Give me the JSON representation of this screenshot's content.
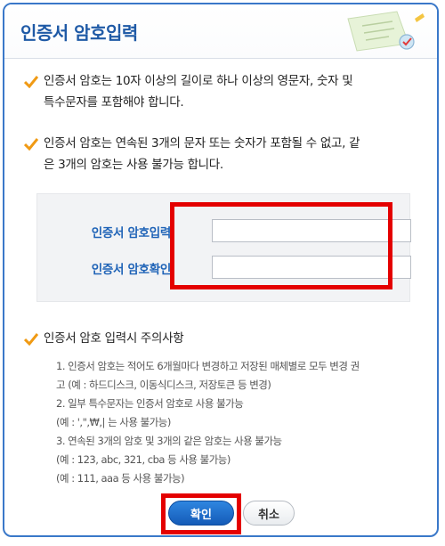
{
  "dialog": {
    "title": "인증서 암호입력"
  },
  "rules": [
    {
      "line1": "인증서 암호는 10자 이상의 길이로 하나 이상의 영문자, 숫자 및",
      "line2": "특수문자를 포함해야 합니다."
    },
    {
      "line1": "인증서 암호는 연속된 3개의 문자 또는 숫자가 포함될 수 없고, 같",
      "line2": "은 3개의 암호는 사용 불가능 합니다."
    }
  ],
  "form": {
    "password_label": "인증서 암호입력",
    "password_value": "",
    "confirm_label": "인증서 암호확인",
    "confirm_value": ""
  },
  "cautions": {
    "heading": "인증서 암호 입력시 주의사항",
    "lines": [
      "1.  인증서 암호는 적어도 6개월마다 변경하고 저장된 매체별로 모두 변경 권",
      "    고 (예 : 하드디스크, 이동식디스크, 저장토큰 등 변경)",
      "2.  일부 특수문자는 인증서 암호로 사용 불가능",
      "    (예 : ',\",₩,| 는 사용 불가능)",
      "3.  연속된 3개의 암호 및 3개의 같은 암호는 사용 불가능",
      "    (예 : 123, abc, 321, cba 등 사용 불가능)",
      "    (예 : 111, aaa 등 사용 불가능)"
    ]
  },
  "buttons": {
    "ok_label": "확인",
    "cancel_label": "취소"
  },
  "colors": {
    "accent": "#1f5aa6",
    "label_blue": "#1f63b7",
    "check_orange": "#f09a14",
    "highlight_red": "#e40000"
  }
}
